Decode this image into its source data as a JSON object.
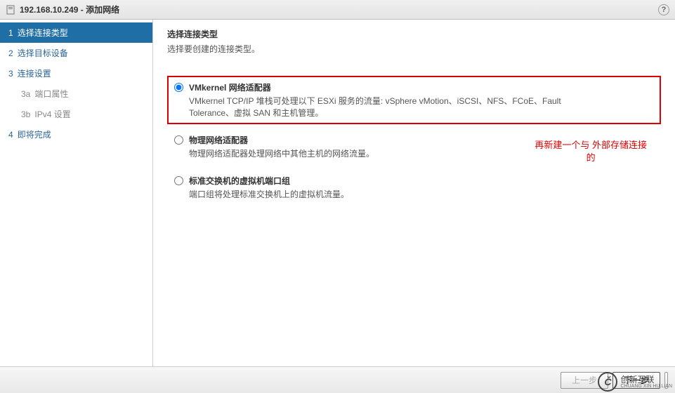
{
  "titlebar": {
    "host": "192.168.10.249",
    "sep": " - ",
    "title": "添加网络"
  },
  "sidebar": {
    "steps": [
      {
        "num": "1",
        "label": "选择连接类型",
        "active": true
      },
      {
        "num": "2",
        "label": "选择目标设备"
      },
      {
        "num": "3",
        "label": "连接设置"
      },
      {
        "num": "3a",
        "label": "端口属性",
        "sub": true
      },
      {
        "num": "3b",
        "label": "IPv4 设置",
        "sub": true
      },
      {
        "num": "4",
        "label": "即将完成"
      }
    ]
  },
  "main": {
    "heading": "选择连接类型",
    "desc": "选择要创建的连接类型。",
    "options": [
      {
        "label": "VMkernel 网络适配器",
        "desc": "VMkernel TCP/IP 堆栈可处理以下 ESXi 服务的流量: vSphere vMotion、iSCSI、NFS、FCoE、Fault Tolerance、虚拟 SAN 和主机管理。",
        "selected": true,
        "highlight": true
      },
      {
        "label": "物理网络适配器",
        "desc": "物理网络适配器处理网络中其他主机的网络流量。"
      },
      {
        "label": "标准交换机的虚拟机端口组",
        "desc": "端口组将处理标准交换机上的虚拟机流量。"
      }
    ],
    "annotation_line1": "再新建一个与  外部存储连接",
    "annotation_line2": "的"
  },
  "footer": {
    "back": "上一步",
    "next": "下一步"
  },
  "watermark": {
    "brand": "创新互联",
    "sub": "CHUANG XIN HU LIAN"
  }
}
